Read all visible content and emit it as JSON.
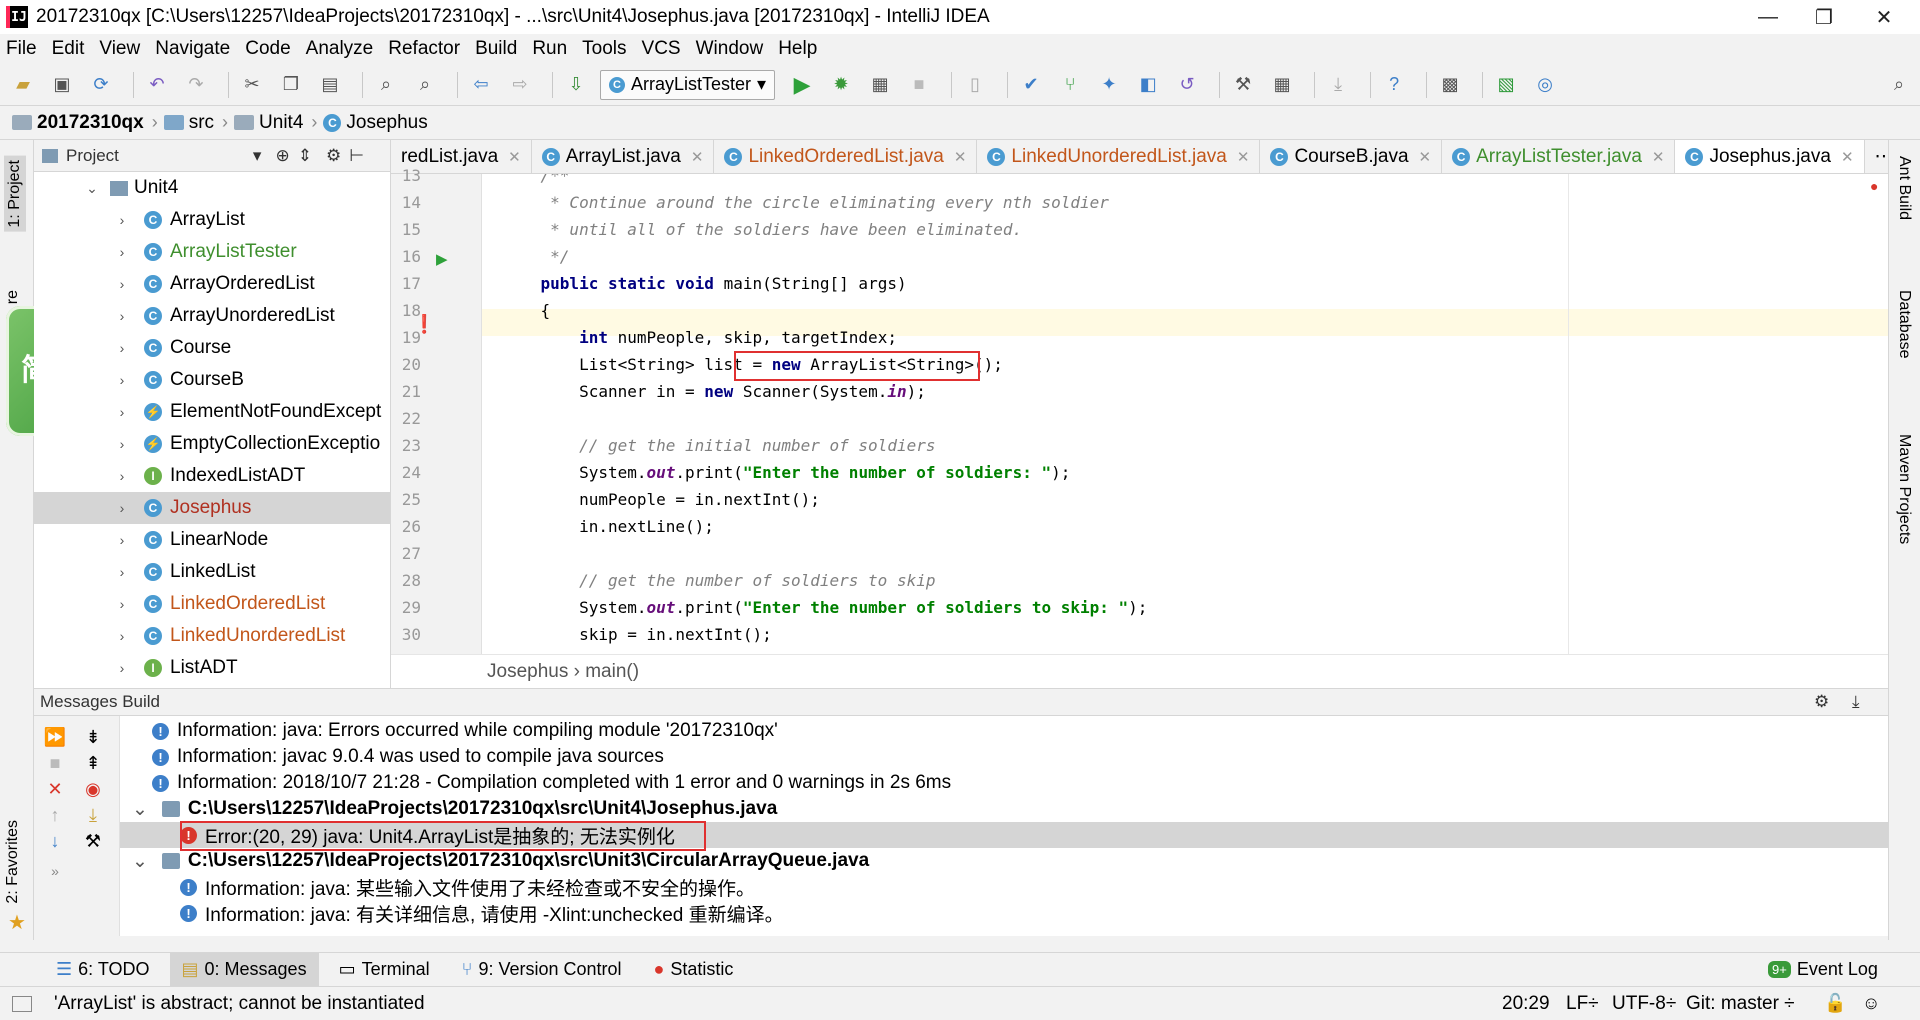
{
  "window": {
    "title": "20172310qx [C:\\Users\\12257\\IdeaProjects\\20172310qx] - ...\\src\\Unit4\\Josephus.java [20172310qx] - IntelliJ IDEA",
    "app_icon_text": "IJ",
    "minimize": "—",
    "restore": "❐",
    "close": "✕"
  },
  "menu": [
    "File",
    "Edit",
    "View",
    "Navigate",
    "Code",
    "Analyze",
    "Refactor",
    "Build",
    "Run",
    "Tools",
    "VCS",
    "Window",
    "Help"
  ],
  "toolbar": {
    "run_config": "ArrayListTester",
    "run_config_arrow": "▾"
  },
  "nav": {
    "items": [
      "20172310qx",
      "src",
      "Unit4",
      "Josephus"
    ]
  },
  "project_panel": {
    "title": "Project",
    "title_arrow": "▾",
    "root": "Unit4",
    "items": [
      {
        "name": "ArrayList",
        "icon": "C",
        "color": "#000000"
      },
      {
        "name": "ArrayListTester",
        "icon": "C",
        "color": "#3f8f2e"
      },
      {
        "name": "ArrayOrderedList",
        "icon": "C",
        "color": "#000000"
      },
      {
        "name": "ArrayUnorderedList",
        "icon": "C",
        "color": "#000000"
      },
      {
        "name": "Course",
        "icon": "C",
        "color": "#000000"
      },
      {
        "name": "CourseB",
        "icon": "C",
        "color": "#000000"
      },
      {
        "name": "ElementNotFoundExcept",
        "icon": "⚡",
        "color": "#000000"
      },
      {
        "name": "EmptyCollectionExceptio",
        "icon": "⚡",
        "color": "#000000"
      },
      {
        "name": "IndexedListADT",
        "icon": "I",
        "color": "#000000"
      },
      {
        "name": "Josephus",
        "icon": "C",
        "color": "#b03020"
      },
      {
        "name": "LinearNode",
        "icon": "C",
        "color": "#000000"
      },
      {
        "name": "LinkedList",
        "icon": "C",
        "color": "#000000"
      },
      {
        "name": "LinkedOrderedList",
        "icon": "C",
        "color": "#c2561a"
      },
      {
        "name": "LinkedUnorderedList",
        "icon": "C",
        "color": "#c2561a"
      },
      {
        "name": "ListADT",
        "icon": "I",
        "color": "#000000"
      }
    ]
  },
  "left_strip": {
    "project_tab": "1: Project",
    "favorites_tab": "2: Favorites",
    "overlay_logo": "简英设",
    "structure_tab": "re"
  },
  "right_strip": {
    "ant": "Ant Build",
    "database": "Database",
    "maven": "Maven Projects"
  },
  "tabs": [
    {
      "label": "redList.java",
      "color": "#000000",
      "active": false
    },
    {
      "label": "ArrayList.java",
      "color": "#000000",
      "active": false
    },
    {
      "label": "LinkedOrderedList.java",
      "color": "#c2561a",
      "active": false
    },
    {
      "label": "LinkedUnorderedList.java",
      "color": "#c2561a",
      "active": false
    },
    {
      "label": "CourseB.java",
      "color": "#000000",
      "active": false
    },
    {
      "label": "ArrayListTester.java",
      "color": "#3f8f2e",
      "active": false
    },
    {
      "label": "Josephus.java",
      "color": "#000000",
      "active": true
    }
  ],
  "tabs_more": "⋯≡",
  "editor": {
    "line_numbers": [
      "13",
      "14",
      "15",
      "16",
      "17",
      "18",
      "19",
      "20",
      "21",
      "22",
      "23",
      "24",
      "25",
      "26",
      "27",
      "28",
      "29",
      "30"
    ],
    "lines": [
      "    /**",
      "     * Continue around the circle eliminating every nth soldier",
      "     * until all of the soldiers have been eliminated.",
      "     */",
      "    public static void main(String[] args)",
      "    {",
      "        int numPeople, skip, targetIndex;",
      "        List<String> list = new ArrayList<String>();",
      "        Scanner in = new Scanner(System.in);",
      "",
      "        // get the initial number of soldiers",
      "        System.out.print(\"Enter the number of soldiers: \");",
      "        numPeople = in.nextInt();",
      "        in.nextLine();",
      "",
      "        // get the number of soldiers to skip",
      "        System.out.print(\"Enter the number of soldiers to skip: \");",
      "        skip = in.nextInt();"
    ],
    "breadcrumb": "Josephus  ›  main()"
  },
  "messages": {
    "header": "Messages Build",
    "rows": [
      {
        "kind": "info",
        "indent": 0,
        "text": "Information: java: Errors occurred while compiling module '20172310qx'"
      },
      {
        "kind": "info",
        "indent": 0,
        "text": "Information: javac 9.0.4 was used to compile java sources"
      },
      {
        "kind": "info",
        "indent": 0,
        "text": "Information: 2018/10/7 21:28 - Compilation completed with 1 error and 0 warnings in 2s 6ms"
      },
      {
        "kind": "file",
        "indent": 0,
        "text": "C:\\Users\\12257\\IdeaProjects\\20172310qx\\src\\Unit4\\Josephus.java"
      },
      {
        "kind": "error",
        "indent": 1,
        "text": "Error:(20, 29)  java: Unit4.ArrayList是抽象的; 无法实例化"
      },
      {
        "kind": "file",
        "indent": 0,
        "text": "C:\\Users\\12257\\IdeaProjects\\20172310qx\\src\\Unit3\\CircularArrayQueue.java"
      },
      {
        "kind": "info",
        "indent": 1,
        "text": "Information: java: 某些输入文件使用了未经检查或不安全的操作。"
      },
      {
        "kind": "info",
        "indent": 1,
        "text": "Information: java: 有关详细信息, 请使用 -Xlint:unchecked 重新编译。"
      }
    ]
  },
  "bottom_tabs": [
    "6: TODO",
    "0: Messages",
    "Terminal",
    "9: Version Control",
    "Statistic"
  ],
  "event_log": {
    "badge": "9+",
    "label": "Event Log"
  },
  "status": {
    "message": "'ArrayList' is abstract; cannot be instantiated",
    "position": "20:29",
    "line_sep": "LF÷",
    "encoding": "UTF-8÷",
    "git": "Git: master ÷"
  },
  "colors": {
    "accent": "#3d7fc9",
    "error": "#d9362b",
    "highlight_box": "#e03030"
  }
}
